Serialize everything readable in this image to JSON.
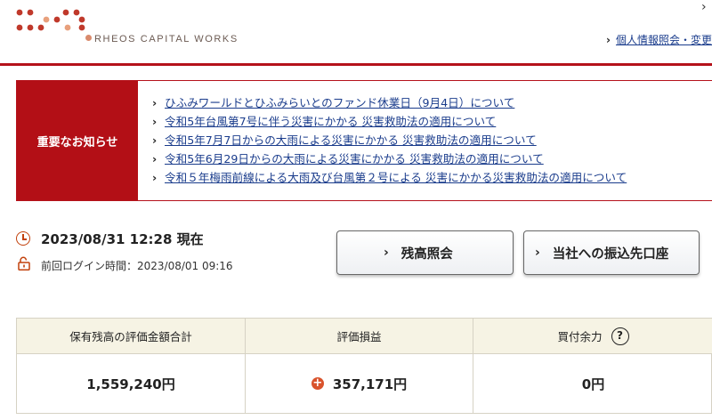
{
  "header": {
    "brand": "RHEOS CAPITAL WORKS",
    "top_chevron": "›",
    "profile_link": "個人情報照会・変更",
    "chevron": "›"
  },
  "notice": {
    "label": "重要なお知らせ",
    "items": [
      "ひふみワールドとひふみらいとのファンド休業日（9月4日）について",
      "令和5年台風第7号に伴う災害にかかる 災害救助法の適用について",
      "令和5年7月7日からの大雨による災害にかかる 災害救助法の適用について",
      "令和5年6月29日からの大雨による災害にかかる 災害救助法の適用について",
      "令和５年梅雨前線による大雨及び台風第２号による 災害にかかる災害救助法の適用について"
    ]
  },
  "status": {
    "now": "2023/08/31 12:28 現在",
    "last_login": "前回ログイン時間：2023/08/01 09:16"
  },
  "buttons": {
    "balance": "残高照会",
    "transfer": "当社への振込先口座"
  },
  "summary": {
    "headers": [
      "保有残高の評価金額合計",
      "評価損益",
      "買付余力"
    ],
    "values": [
      "1,559,240円",
      "357,171円",
      "0円"
    ],
    "help": "?",
    "plus": "+"
  },
  "colors": {
    "brand_red": "#b30f16",
    "link_blue": "#1a3c8c",
    "table_header_bg": "#f6f3e4"
  }
}
